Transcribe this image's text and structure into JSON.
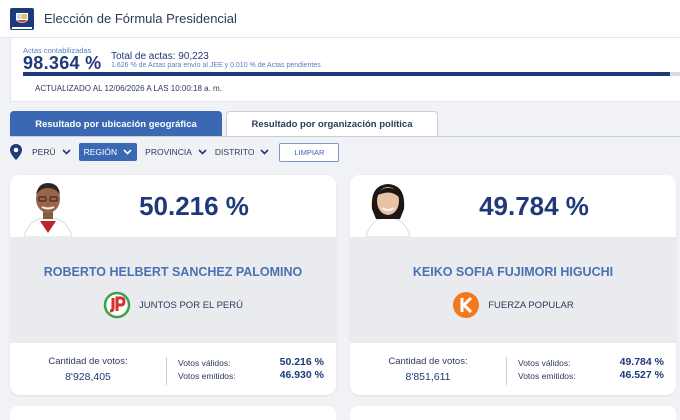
{
  "header": {
    "title": "Elección de Fórmula Presidencial"
  },
  "summary": {
    "actas_label": "Actas contabilizadas",
    "actas_percent": "98.364 %",
    "progress_percent": 98.364,
    "total_label": "Total de actas: 90,223",
    "pending_text": "1.626 % de Actas para envío al JEE y 0.010 % de Actas pendientes",
    "updated": "ACTUALIZADO AL 12/06/2026 A LAS 10:00:18 a. m."
  },
  "tabs": [
    {
      "label": "Resultado por ubicación geográfica",
      "active": true
    },
    {
      "label": "Resultado por organización política",
      "active": false
    }
  ],
  "filters": {
    "items": [
      {
        "label": "PERÚ",
        "active": false
      },
      {
        "label": "REGIÓN",
        "active": true
      },
      {
        "label": "PROVINCIA",
        "active": false
      },
      {
        "label": "DISTRITO",
        "active": false
      }
    ],
    "clear_label": "LIMPIAR"
  },
  "candidates": [
    {
      "percent": "50.216 %",
      "name": "ROBERTO HELBERT SANCHEZ PALOMINO",
      "party": "JUNTOS POR EL PERÚ",
      "party_color": "#d3322f",
      "votes_label": "Cantidad de votos:",
      "votes": "8'928,405",
      "valid_label": "Votos válidos:",
      "valid": "50.216 %",
      "emitted_label": "Votos emitidos:",
      "emitted": "46.930 %"
    },
    {
      "percent": "49.784 %",
      "name": "KEIKO SOFIA FUJIMORI HIGUCHI",
      "party": "FUERZA POPULAR",
      "party_color": "#f07a1c",
      "votes_label": "Cantidad de votos:",
      "votes": "8'851,611",
      "valid_label": "Votos válidos:",
      "valid": "49.784 %",
      "emitted_label": "Votos emitidos:",
      "emitted": "46.527 %"
    }
  ],
  "colors": {
    "primary": "#1e3a78",
    "accent": "#3a68b3",
    "name": "#4c70b4",
    "background": "#f1f2f5"
  }
}
